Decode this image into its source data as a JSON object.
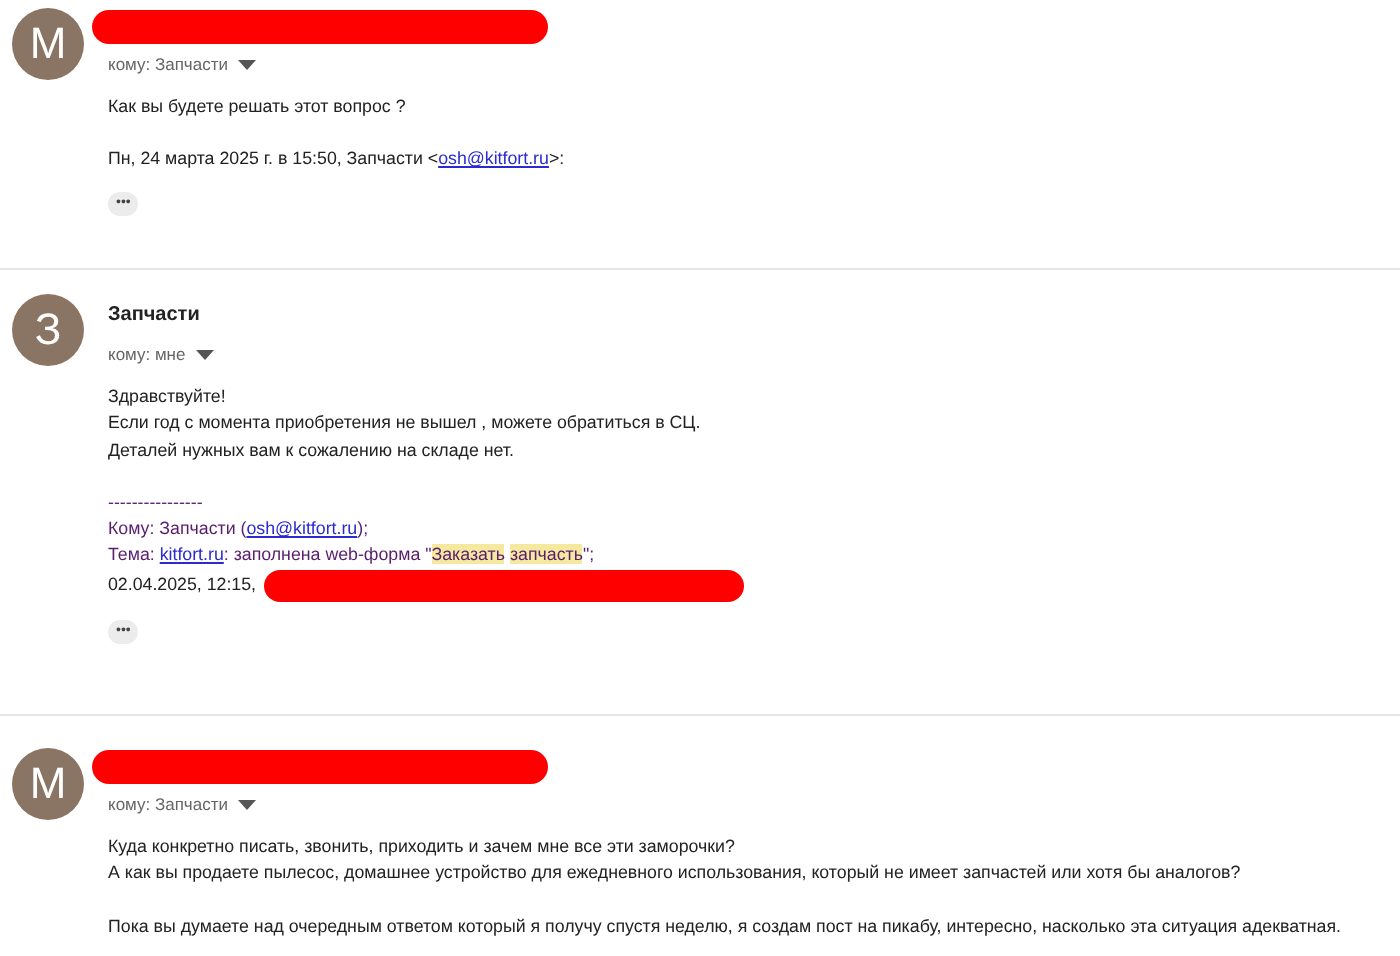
{
  "messages": [
    {
      "avatar": "M",
      "sender": {
        "redacted": true
      },
      "recipient": "кому: Запчасти",
      "blocks": [
        {
          "lines": [
            {
              "quoted": false,
              "segments": [
                {
                  "kind": "text",
                  "text": "Как вы будете решать этот вопрос ?"
                }
              ]
            }
          ]
        },
        {
          "lines": [
            {
              "quoted": false,
              "segments": [
                {
                  "kind": "text",
                  "text": "Пн, 24 марта 2025 г. в 15:50, Запчасти <"
                },
                {
                  "kind": "link",
                  "text": "osh@kitfort.ru"
                },
                {
                  "kind": "text",
                  "text": ">:"
                }
              ]
            }
          ]
        }
      ],
      "more_button": "•••"
    },
    {
      "avatar": "З",
      "sender": {
        "redacted": false,
        "name": "Запчасти"
      },
      "recipient": "кому: мне",
      "blocks": [
        {
          "lines": [
            {
              "quoted": false,
              "segments": [
                {
                  "kind": "text",
                  "text": "Здравствуйте!"
                }
              ]
            },
            {
              "quoted": false,
              "segments": [
                {
                  "kind": "text",
                  "text": "Если год с момента приобретения не вышел , можете обратиться в СЦ."
                }
              ]
            },
            {
              "quoted": false,
              "segments": [
                {
                  "kind": "text",
                  "text": "Деталей нужных вам  к сожалению на складе нет."
                }
              ]
            }
          ]
        },
        {
          "lines": [
            {
              "quoted": true,
              "segments": [
                {
                  "kind": "text",
                  "text": "----------------"
                }
              ]
            },
            {
              "quoted": true,
              "segments": [
                {
                  "kind": "text",
                  "text": "Кому: Запчасти ("
                },
                {
                  "kind": "link",
                  "text": "osh@kitfort.ru"
                },
                {
                  "kind": "text",
                  "text": ");"
                }
              ]
            },
            {
              "quoted": true,
              "segments": [
                {
                  "kind": "text",
                  "text": "Тема: "
                },
                {
                  "kind": "link",
                  "text": "kitfort.ru"
                },
                {
                  "kind": "text",
                  "text": ": заполнена web-форма \""
                },
                {
                  "kind": "highlight",
                  "text": "Заказать"
                },
                {
                  "kind": "space"
                },
                {
                  "kind": "highlight",
                  "text": "запчасть"
                },
                {
                  "kind": "text",
                  "text": "\";"
                }
              ]
            },
            {
              "quoted": false,
              "segments": [
                {
                  "kind": "text",
                  "text": "02.04.2025, 12:15,"
                },
                {
                  "kind": "redaction"
                }
              ]
            }
          ]
        }
      ],
      "more_button": "•••"
    },
    {
      "avatar": "M",
      "sender": {
        "redacted": true
      },
      "recipient": "кому: Запчасти",
      "blocks": [
        {
          "lines": [
            {
              "quoted": false,
              "segments": [
                {
                  "kind": "text",
                  "text": "Куда конкретно писать, звонить, приходить и зачем мне все эти заморочки?"
                }
              ]
            },
            {
              "quoted": false,
              "segments": [
                {
                  "kind": "text",
                  "text": "А как вы продаете пылесос, домашнее устройство для ежедневного использования, который не имеет запчастей или хотя бы аналогов?"
                }
              ]
            }
          ]
        },
        {
          "lines": [
            {
              "quoted": false,
              "segments": [
                {
                  "kind": "text",
                  "text": "Пока вы думаете над очередным ответом который я получу спустя неделю, я создам пост на пикабу, интересно, насколько  эта ситуация адекватная."
                }
              ]
            }
          ]
        }
      ]
    }
  ]
}
